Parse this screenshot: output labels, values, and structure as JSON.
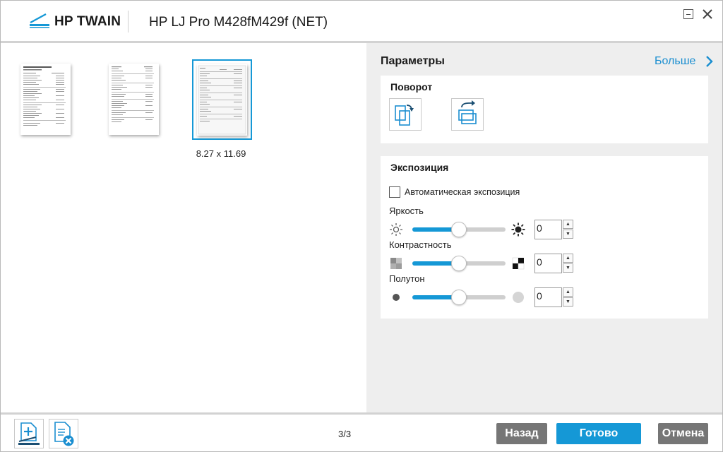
{
  "header": {
    "app_name": "HP TWAIN",
    "device_name": "HP LJ Pro M428fM429f (NET)"
  },
  "preview": {
    "selected_page_size": "8.27 x 11.69",
    "thumbnail_count": 3,
    "selected_index": 3
  },
  "settings": {
    "title": "Параметры",
    "more_label": "Больше",
    "rotation": {
      "title": "Поворот",
      "rotate_left_icon": "rotate-left-icon",
      "rotate_right_icon": "rotate-right-icon"
    },
    "exposure": {
      "title": "Экспозиция",
      "auto_label": "Автоматическая экспозиция",
      "auto_checked": false,
      "brightness": {
        "label": "Яркость",
        "value": "0",
        "level": 0.5
      },
      "contrast": {
        "label": "Контрастность",
        "value": "0",
        "level": 0.5
      },
      "midtone": {
        "label": "Полутон",
        "value": "0",
        "level": 0.5
      }
    }
  },
  "footer": {
    "page_counter": "3/3",
    "back_label": "Назад",
    "done_label": "Готово",
    "cancel_label": "Отмена"
  },
  "colors": {
    "accent": "#1598d6",
    "button_gray": "#767676",
    "pane_gray": "#eeeeee"
  }
}
